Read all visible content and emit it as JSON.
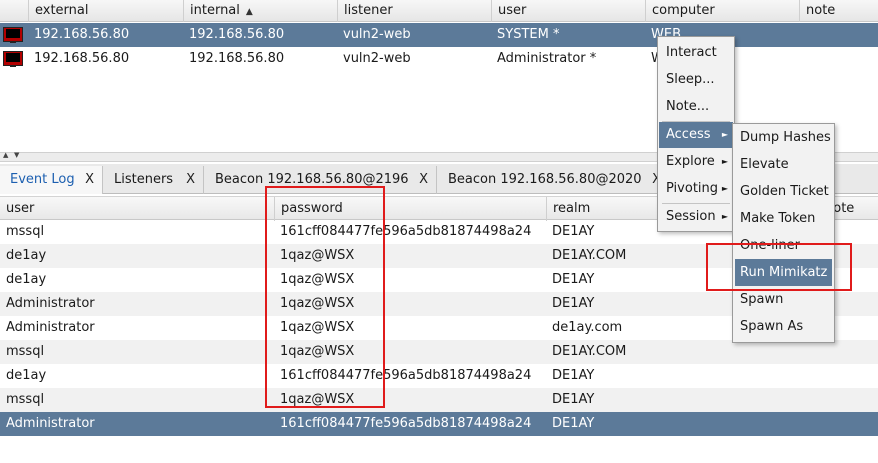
{
  "beacons": {
    "columns": [
      "external",
      "internal",
      "listener",
      "user",
      "computer",
      "note"
    ],
    "sort_indicator": "▲",
    "rows": [
      {
        "external": "192.168.56.80",
        "internal": "192.168.56.80",
        "listener": "vuln2-web",
        "user": "SYSTEM *",
        "computer": "WEB",
        "note": ""
      },
      {
        "external": "192.168.56.80",
        "internal": "192.168.56.80",
        "listener": "vuln2-web",
        "user": "Administrator *",
        "computer": "W",
        "note": ""
      }
    ]
  },
  "tabs": [
    {
      "label": "Event Log",
      "close": "X"
    },
    {
      "label": "Listeners",
      "close": "X"
    },
    {
      "label": "Beacon 192.168.56.80@2196",
      "close": "X"
    },
    {
      "label": "Beacon 192.168.56.80@2020",
      "close": "X"
    }
  ],
  "credentials": {
    "columns": [
      "user",
      "password",
      "realm",
      "note"
    ],
    "rows": [
      {
        "user": "mssql",
        "password": "161cff084477fe596a5db81874498a24",
        "realm": "DE1AY"
      },
      {
        "user": "de1ay",
        "password": "1qaz@WSX",
        "realm": "DE1AY.COM"
      },
      {
        "user": "de1ay",
        "password": "1qaz@WSX",
        "realm": "DE1AY"
      },
      {
        "user": "Administrator",
        "password": "1qaz@WSX",
        "realm": "DE1AY"
      },
      {
        "user": "Administrator",
        "password": "1qaz@WSX",
        "realm": "de1ay.com"
      },
      {
        "user": "mssql",
        "password": "1qaz@WSX",
        "realm": "DE1AY.COM"
      },
      {
        "user": "de1ay",
        "password": "161cff084477fe596a5db81874498a24",
        "realm": "DE1AY"
      },
      {
        "user": "mssql",
        "password": "1qaz@WSX",
        "realm": "DE1AY"
      },
      {
        "user": "Administrator",
        "password": "161cff084477fe596a5db81874498a24",
        "realm": "DE1AY"
      }
    ]
  },
  "context_menu": {
    "items": [
      "Interact",
      "Sleep...",
      "Note...",
      "Access",
      "Explore",
      "Pivoting",
      "Session"
    ],
    "submenu_arrow": "►"
  },
  "access_submenu": {
    "items": [
      "Dump Hashes",
      "Elevate",
      "Golden Ticket",
      "Make Token",
      "One-liner",
      "Run Mimikatz",
      "Spawn",
      "Spawn As"
    ]
  },
  "colors": {
    "selection": "#5c7a99",
    "annotation": "#e01b1b",
    "active_tab_text": "#1c5fb0"
  },
  "icons": {
    "beacon": "monitor-icon",
    "splitter": "collapse-arrows-icon"
  }
}
